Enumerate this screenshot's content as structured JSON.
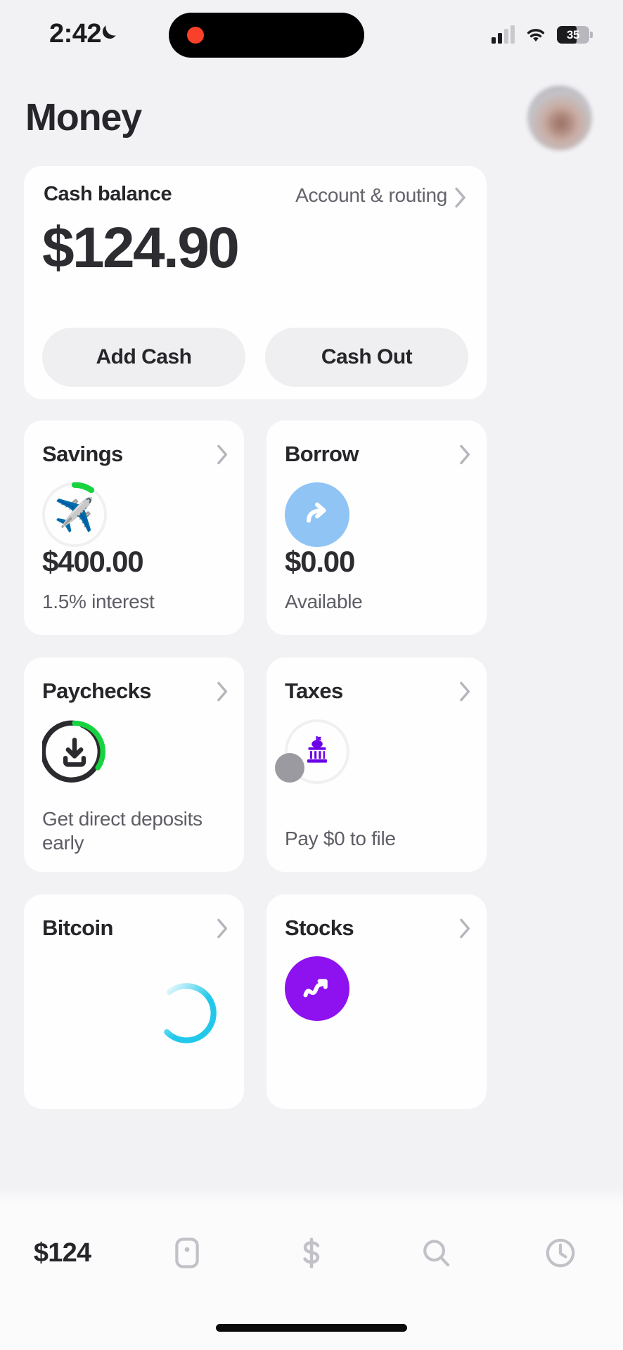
{
  "status_bar": {
    "time": "2:42",
    "dnd_icon": "crescent-moon-icon",
    "recording_dot": "record-dot-icon",
    "cellular_icon": "cellular-bars-icon",
    "cellular_bars_filled": 2,
    "wifi_icon": "wifi-icon",
    "battery_percent": "35",
    "battery_icon": "battery-icon"
  },
  "header": {
    "title": "Money",
    "avatar_label": "profile-avatar"
  },
  "balance_card": {
    "label": "Cash balance",
    "account_routing_link": "Account & routing",
    "chevron_icon": "chevron-right-icon",
    "amount": "$124.90",
    "add_cash_label": "Add Cash",
    "cash_out_label": "Cash Out"
  },
  "tiles": [
    {
      "title": "Savings",
      "icon": "airplane-emoji-ring-icon",
      "amount": "$400.00",
      "subtitle": "1.5% interest",
      "chevron_icon": "chevron-right-icon",
      "accent": "#2ecc40"
    },
    {
      "title": "Borrow",
      "icon": "arrow-forward-circle-icon",
      "amount": "$0.00",
      "subtitle": "Available",
      "chevron_icon": "chevron-right-icon",
      "accent": "#8fc4f5"
    },
    {
      "title": "Paychecks",
      "icon": "download-arrow-ring-icon",
      "amount": "",
      "subtitle": "Get direct deposits early",
      "chevron_icon": "chevron-right-icon",
      "accent": "#17d33f"
    },
    {
      "title": "Taxes",
      "icon": "government-building-icon",
      "amount": "",
      "subtitle": "Pay $0 to file",
      "chevron_icon": "chevron-right-icon",
      "accent": "#6b00e8"
    },
    {
      "title": "Bitcoin",
      "icon": "loading-spinner-icon",
      "amount": "",
      "subtitle": "",
      "chevron_icon": "chevron-right-icon",
      "accent": "#22c8ea"
    },
    {
      "title": "Stocks",
      "icon": "trending-up-circle-icon",
      "amount": "",
      "subtitle": "",
      "chevron_icon": "chevron-right-icon",
      "accent": "#8e12f0"
    }
  ],
  "tab_bar": {
    "items": [
      {
        "label": "$124",
        "icon": "money-balance-tab",
        "active": true
      },
      {
        "label": "",
        "icon": "card-icon",
        "active": false
      },
      {
        "label": "",
        "icon": "dollar-sign-icon",
        "active": false
      },
      {
        "label": "",
        "icon": "search-icon",
        "active": false
      },
      {
        "label": "",
        "icon": "clock-icon",
        "active": false
      }
    ]
  },
  "colors": {
    "background": "#f2f1f4",
    "card": "#fefefe",
    "text_primary": "#26262a",
    "text_secondary": "#5d5d65",
    "pill_bg": "#efeff1",
    "tab_inactive": "#bdbdc3"
  }
}
